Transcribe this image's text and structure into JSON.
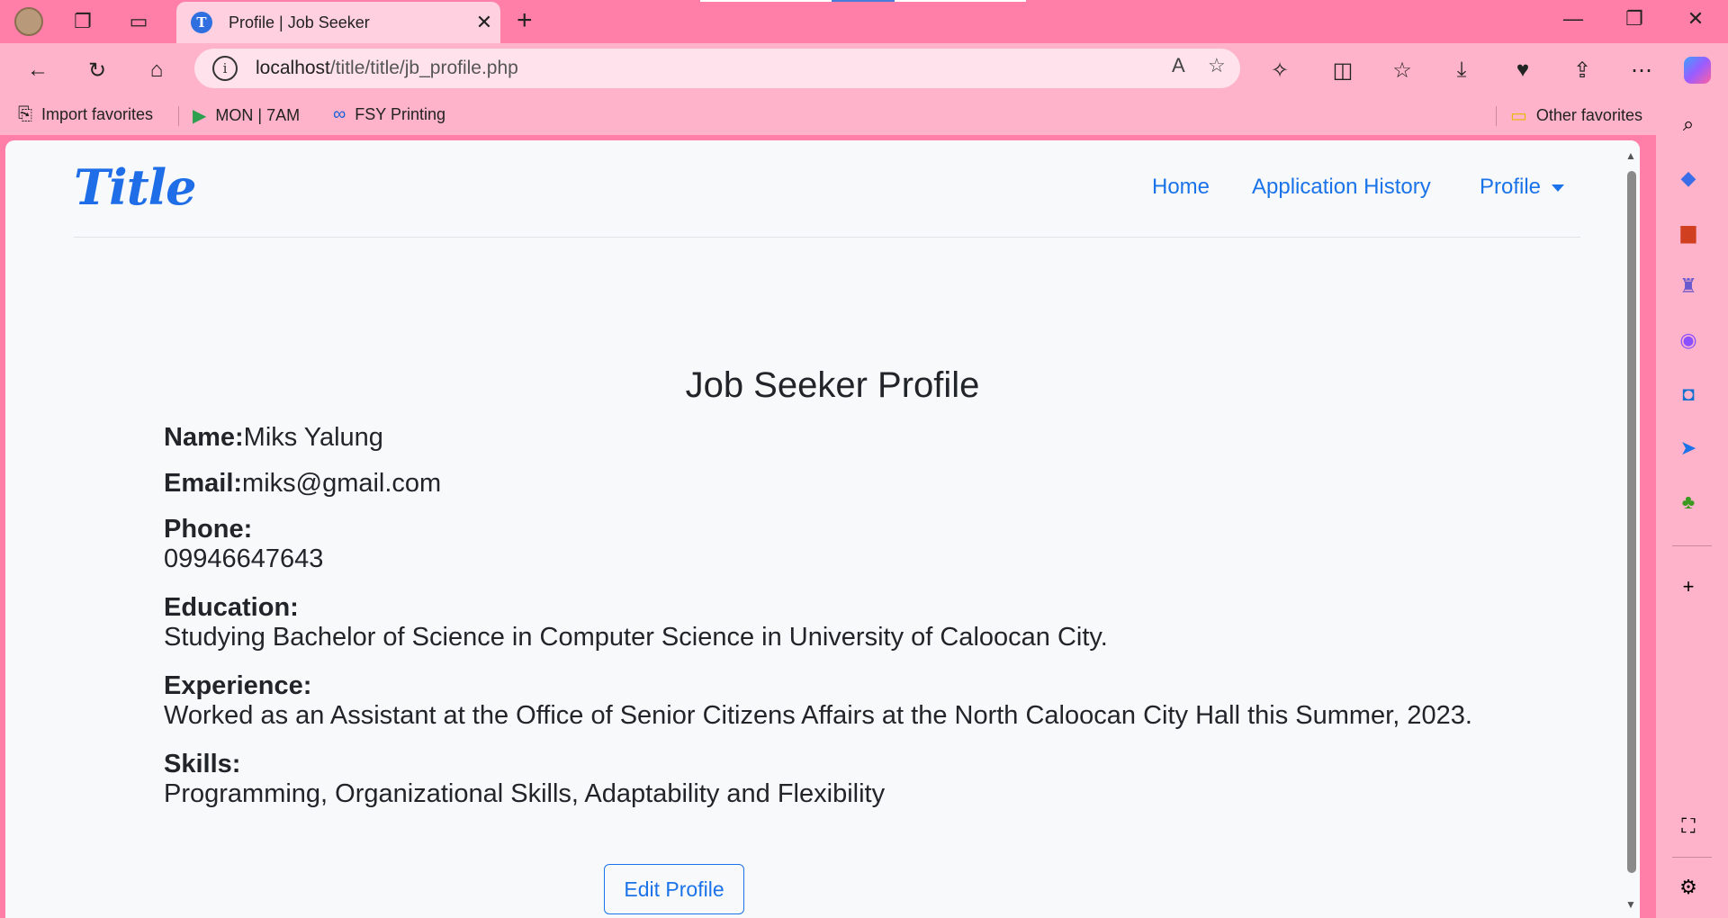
{
  "browser": {
    "tab_title": "Profile | Job Seeker",
    "tab_favicon_letter": "T",
    "url_host": "localhost",
    "url_path": "/title/title/jb_profile.php",
    "favorites": [
      {
        "label": "Import favorites",
        "icon": "import-icon"
      },
      {
        "label": "MON | 7AM",
        "icon": "meet-icon"
      },
      {
        "label": "FSY Printing",
        "icon": "meta-icon"
      }
    ],
    "other_favorites": "Other favorites"
  },
  "nav": {
    "brand": "Title",
    "links": [
      "Home",
      "Application History",
      "Profile"
    ]
  },
  "profile": {
    "heading": "Job Seeker Profile",
    "name_label": "Name:",
    "name": "Miks Yalung",
    "email_label": "Email:",
    "email": "miks@gmail.com",
    "phone_label": "Phone:",
    "phone": "09946647643",
    "education_label": "Education:",
    "education": "Studying Bachelor of Science in Computer Science in University of Caloocan City.",
    "experience_label": "Experience:",
    "experience": "Worked as an Assistant at the Office of Senior Citizens Affairs at the North Caloocan City Hall this Summer, 2023.",
    "skills_label": "Skills:",
    "skills": "Programming, Organizational Skills, Adaptability and Flexibility",
    "edit_button": "Edit Profile"
  },
  "colors": {
    "chrome": "#ff7fa8",
    "toolbar": "#ffb3cb",
    "link": "#1a73e8",
    "page_bg": "#f8f9fa"
  }
}
